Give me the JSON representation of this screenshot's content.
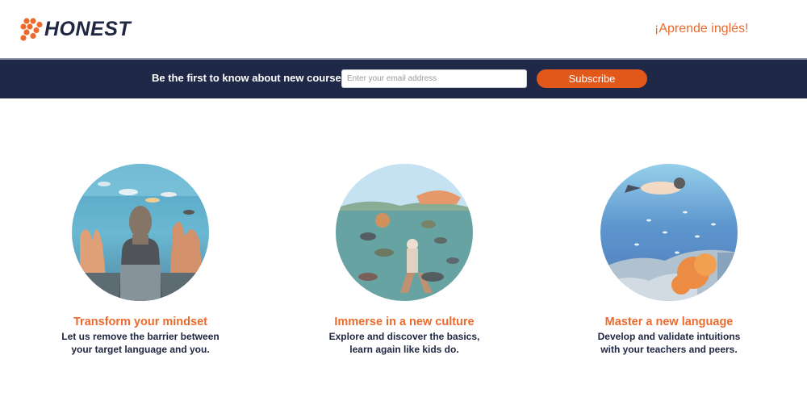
{
  "header": {
    "logo_text": "HONEST",
    "language_link": "¡Aprende inglés!"
  },
  "subscribe_bar": {
    "prompt": "Be the first to know about new courses:",
    "email_placeholder": "Enter your email address",
    "button_label": "Subscribe"
  },
  "features": [
    {
      "title": "Transform your mindset",
      "desc_line1": "Let us remove the barrier between",
      "desc_line2": "your target language and you."
    },
    {
      "title": "Immerse in a new culture",
      "desc_line1": "Explore and discover the basics,",
      "desc_line2": "learn again like kids do."
    },
    {
      "title": "Master a new language",
      "desc_line1": "Develop and validate intuitions",
      "desc_line2": "with your teachers and peers."
    }
  ],
  "colors": {
    "brand_orange": "#ec6a2c",
    "button_orange": "#e2581b",
    "navy": "#1f2847",
    "text_navy": "#202742"
  },
  "icons": {
    "logo_mark": "honeycomb-logo-icon"
  }
}
